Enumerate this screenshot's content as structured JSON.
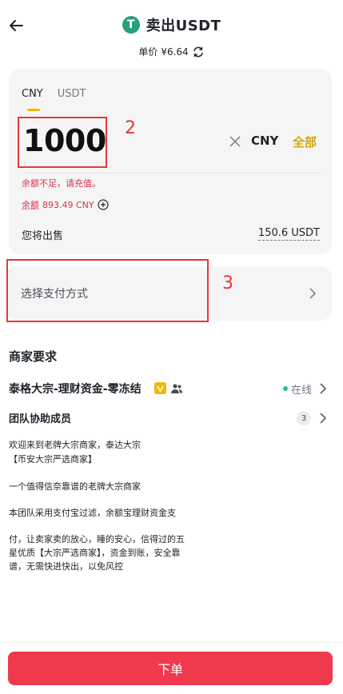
{
  "header": {
    "title": "卖出USDT",
    "logo_glyph": "T",
    "price_label": "单价",
    "price_value": "¥6.64"
  },
  "amount": {
    "tabs": [
      "CNY",
      "USDT"
    ],
    "value": "1000",
    "unit": "CNY",
    "all_label": "全部",
    "error": "余额不足，请充值。",
    "balance_label": "余额",
    "balance_value": "893.49 CNY",
    "sell_label": "您将出售",
    "sell_value": "150.6 USDT"
  },
  "annotations": {
    "a2": "2",
    "a3": "3"
  },
  "payment": {
    "label": "选择支付方式"
  },
  "merchant": {
    "heading": "商家要求",
    "name": "泰格大宗-理财资金-零冻结",
    "status": "在线",
    "team_label": "团队协助成员",
    "team_count": "3",
    "description": [
      "欢迎来到老牌大宗商家，泰达大宗",
      "【币安大宗严选商家】",
      "一个值得信奈靠谱的老牌大宗商家",
      "本团队采用支付宝过滤，余额宝理财资金支",
      "付，让卖家卖的放心，睡的安心，信得过的五",
      "星优质【大宗严选商家】，资金到账，安全靠",
      "谱，无需快进快出，以免风控"
    ]
  },
  "footer": {
    "order_label": "下单"
  },
  "colors": {
    "accent_yellow": "#f0b90b",
    "error_red": "#d9304e",
    "button_red": "#f0394d",
    "online_green": "#2ebd85"
  }
}
